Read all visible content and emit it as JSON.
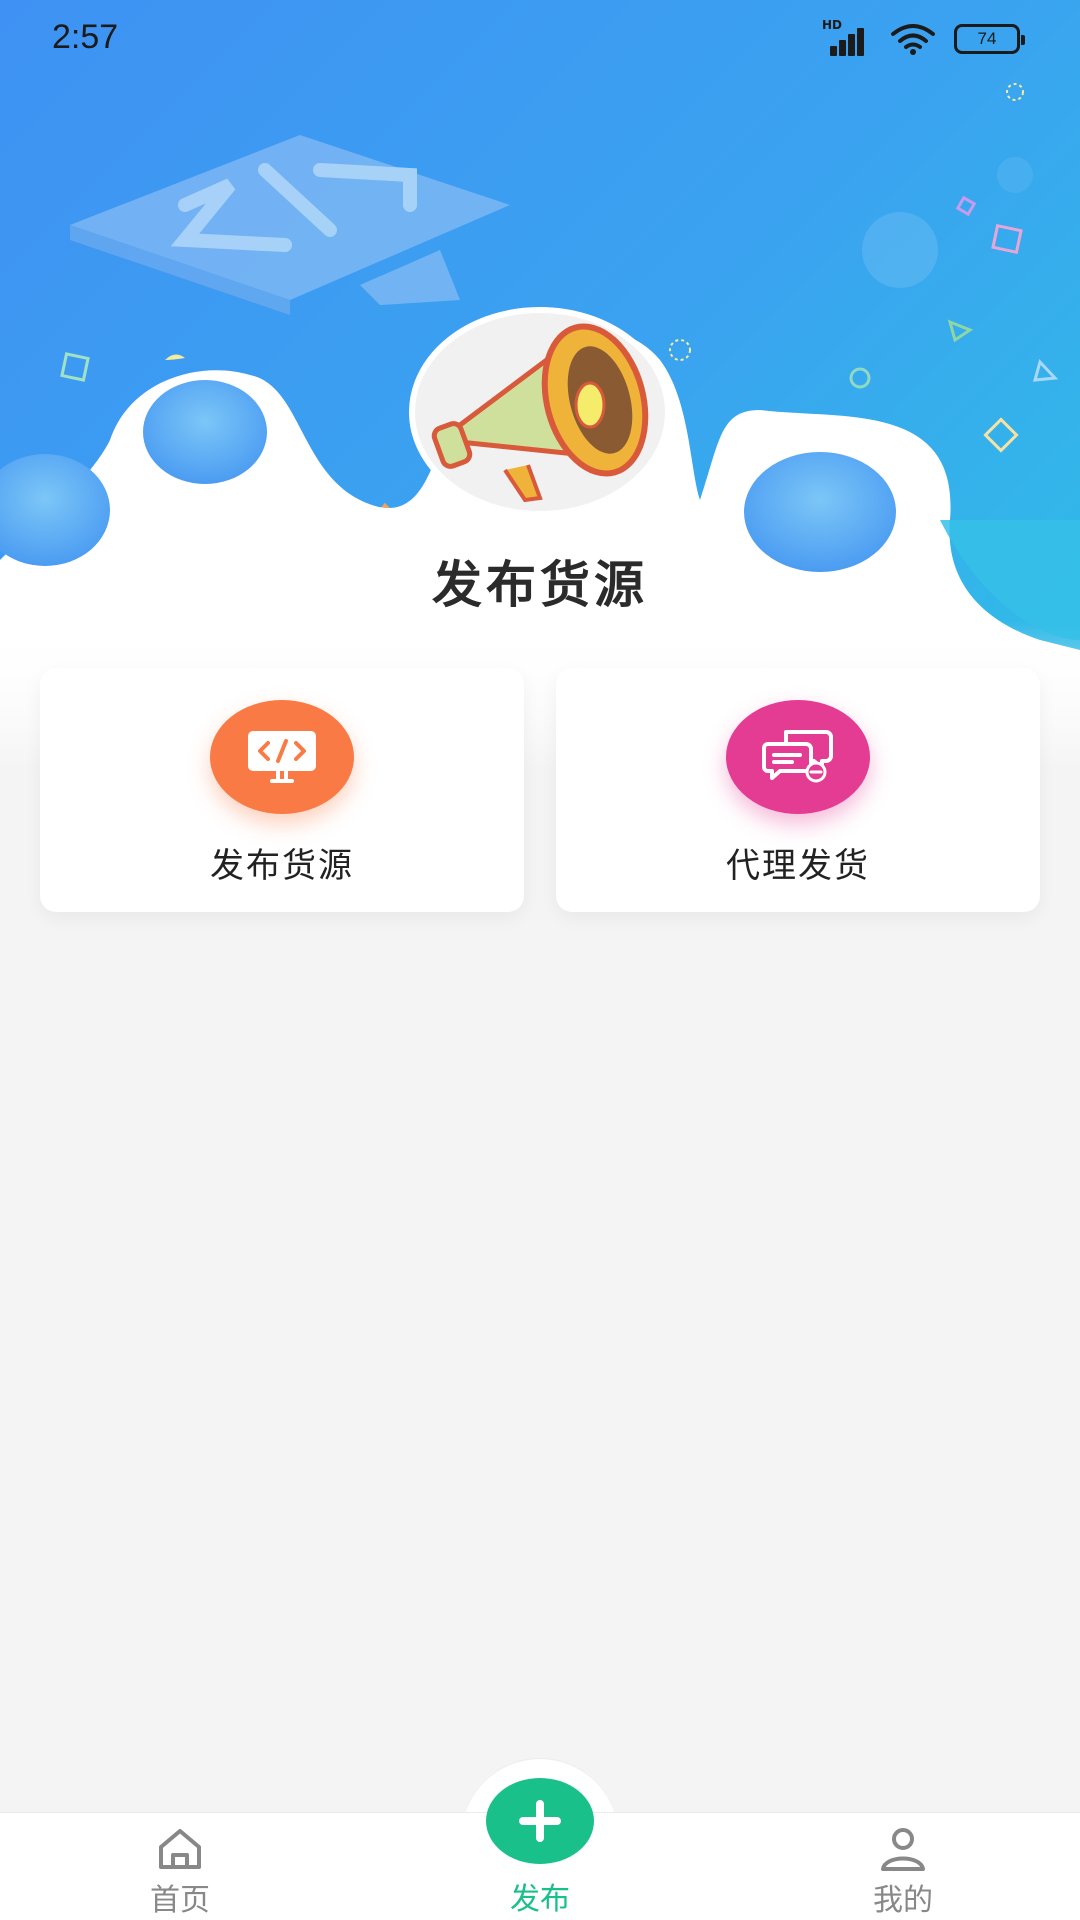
{
  "status_bar": {
    "time": "2:57",
    "battery": "74",
    "network_label": "HD"
  },
  "hero": {
    "title": "发布货源"
  },
  "actions": [
    {
      "label": "发布货源",
      "icon": "code-monitor-icon",
      "color": "#f97a45"
    },
    {
      "label": "代理发货",
      "icon": "chat-bubbles-icon",
      "color": "#e43b93"
    }
  ],
  "bottom_nav": {
    "home": {
      "label": "首页",
      "icon": "home-icon"
    },
    "publish": {
      "label": "发布",
      "icon": "plus-icon",
      "active": true
    },
    "mine": {
      "label": "我的",
      "icon": "person-icon"
    }
  },
  "colors": {
    "accent": "#19c08a",
    "hero_blue": "#3aa3f0",
    "inactive": "#888888"
  }
}
